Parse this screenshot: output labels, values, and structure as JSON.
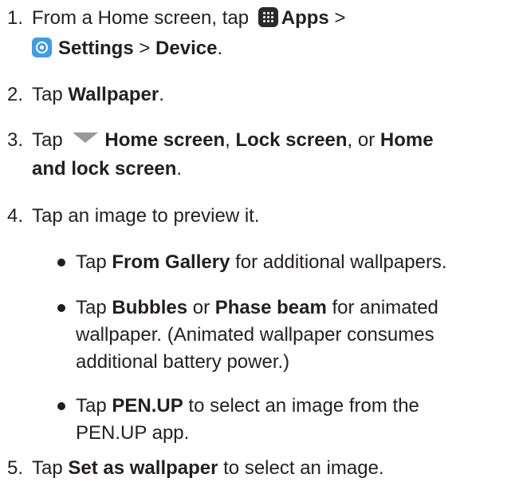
{
  "steps": [
    {
      "num": "1.",
      "line1_prefix": "From a Home screen, tap",
      "apps_icon": "apps-grid-icon",
      "apps_label": "Apps",
      "sep1": ">",
      "settings_icon": "settings-gear-icon",
      "settings_label": "Settings",
      "sep2": ">",
      "device_label": "Device",
      "end": "."
    },
    {
      "num": "2.",
      "prefix": "Tap",
      "wallpaper_label": "Wallpaper",
      "end": "."
    },
    {
      "num": "3.",
      "prefix": "Tap",
      "dropdown_icon": "dropdown-triangle-icon",
      "home_screen": "Home screen",
      "sep_a": ",",
      "lock_screen": "Lock screen",
      "sep_b": ", or",
      "home_lock_a": "Home",
      "home_lock_b": "and lock screen",
      "end": "."
    },
    {
      "num": "4.",
      "text": "Tap an image to preview it."
    },
    {
      "num": "5.",
      "prefix": "Tap",
      "set_label": "Set as wallpaper",
      "suffix": "to select an image."
    }
  ],
  "bullets": [
    {
      "prefix": "Tap",
      "bold": "From Gallery",
      "suffix": "for additional wallpapers."
    },
    {
      "prefix": "Tap",
      "bold1": "Bubbles",
      "mid": "or",
      "bold2": "Phase beam",
      "suffix1": "for animated",
      "line2": "wallpaper. (Animated wallpaper consumes",
      "line3": "additional battery power.)"
    },
    {
      "prefix": "Tap",
      "bold": "PEN.UP",
      "suffix": "to select an image from the",
      "line2": "PEN.UP app."
    }
  ],
  "colors": {
    "text": "#231f20",
    "settings_icon_bg": "#3f9ce8",
    "apps_icon_bg": "#2a2a2a",
    "dropdown_icon": "#9a9a9a"
  }
}
